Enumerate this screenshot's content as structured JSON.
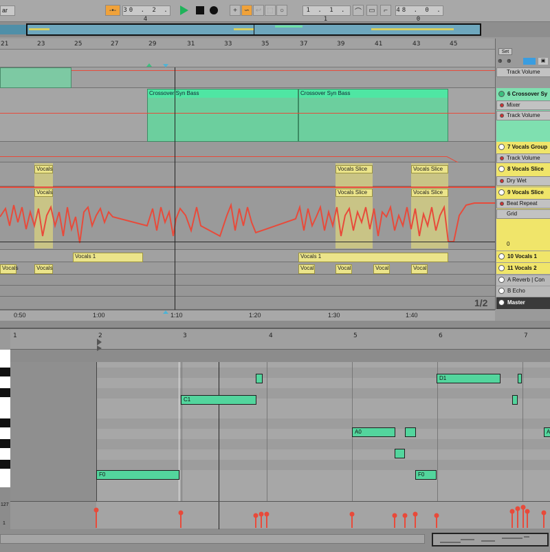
{
  "transport": {
    "left_dropdown": "ar",
    "arrangement_position": "30 .   2 .   4",
    "loop_start": "1 .   1 .   1",
    "loop_length": "48 .   0 .   0"
  },
  "colors": {
    "accent": "#f0a23a",
    "green_clip": "#4fe6a3",
    "yellow_clip": "#ebe48a",
    "automation": "#e84a3a",
    "play_green": "#1fb35a"
  },
  "icons": [
    "follow-icon",
    "play-icon",
    "stop-icon",
    "record-icon",
    "plus-icon",
    "link-icon",
    "arrow-icon",
    "fit-icon",
    "circle-icon",
    "curve-icon",
    "loop-icon",
    "punch-icon"
  ],
  "arrangement": {
    "bars": [
      "21",
      "23",
      "25",
      "27",
      "29",
      "31",
      "33",
      "35",
      "37",
      "39",
      "41",
      "43",
      "45"
    ],
    "time_markers": [
      "0:50",
      "1:00",
      "1:10",
      "1:20",
      "1:30",
      "1:40"
    ],
    "page_indicator": "1/2",
    "clips": {
      "synbass_1": "Crossover Syn Bass",
      "synbass_2": "Crossover Syn Bass",
      "vocals_a": "Vocals",
      "vocals_b": "Vocals",
      "vocals_slice_1": "Vocals Slice",
      "vocals_slice_2": "Vocals Slice",
      "vocals_slice_3": "Vocals Slice",
      "vocals_slice_4": "Vocals Slice",
      "vocals_1a": "Vocals 1",
      "vocals_1b": "Vocals 1",
      "small_1": "Vocals",
      "small_2": "Vocals",
      "small_3": "Vocal",
      "small_4": "Vocal",
      "small_5": "Vocal",
      "small_6": "Vocal"
    }
  },
  "panel": {
    "set_label": "Set",
    "track_volume_top": "Track Volume",
    "track6": "6 Crossover Sy",
    "mixer": "Mixer",
    "track_volume_6": "Track Volume",
    "track7": "7 Vocals Group",
    "track_volume_7": "Track Volume",
    "track8": "8 Vocals Slice",
    "dry_wet": "Dry Wet",
    "track9": "9 Vocals Slice",
    "beat_repeat": "Beat Repeat",
    "grid": "Grid",
    "zero": "0",
    "track10": "10 Vocals 1",
    "track11": "11 Vocals 2",
    "return_a": "A Reverb | Con",
    "return_b": "B Echo",
    "master": "Master"
  },
  "editor": {
    "bars": [
      "1",
      "2",
      "3",
      "4",
      "5",
      "6",
      "7"
    ],
    "vel_top": "127",
    "vel_bottom": "1",
    "notes": {
      "d1": "D1",
      "c1": "C1",
      "a0": "A0",
      "a0b": "A",
      "f0": "F0",
      "f0b": "F0"
    }
  }
}
